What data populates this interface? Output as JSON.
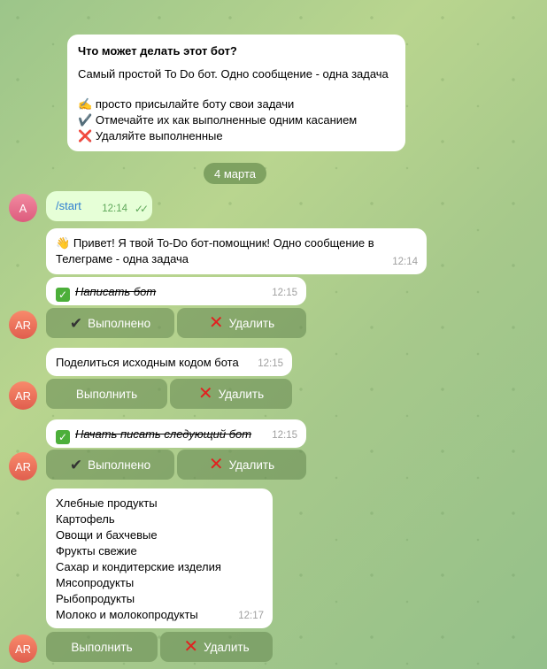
{
  "intro": {
    "title": "Что может делать этот бот?",
    "desc": "Самый простой To Do бот. Одно сообщение - одна задача",
    "line1_emoji": "✍️",
    "line1": "просто присылайте боту свои задачи",
    "line2_emoji": "✔️",
    "line2": "Отмечайте их как выполненные одним касанием",
    "line3_emoji": "❌",
    "line3": "Удаляйте выполненные"
  },
  "date_separator": "4 марта",
  "messages": [
    {
      "id": "start",
      "text": "/start",
      "time": "12:14",
      "avatar": "A"
    },
    {
      "id": "greeting",
      "emoji": "👋",
      "text": "Привет! Я твой To-Do бот-помощник! Одно сообщение в Телеграме - одна задача",
      "time": "12:14"
    },
    {
      "id": "task1",
      "emoji": "✅",
      "text": "Написать бот",
      "time": "12:15",
      "avatar": "AR",
      "done": true
    },
    {
      "id": "task2",
      "text": "Поделиться исходным кодом бота",
      "time": "12:15",
      "avatar": "AR",
      "done": false
    },
    {
      "id": "task3",
      "emoji": "✅",
      "text": "Начать писать следующий бот",
      "time": "12:15",
      "avatar": "AR",
      "done": true
    },
    {
      "id": "task4",
      "lines": [
        "Хлебные продукты",
        "Картофель",
        "Овощи и бахчевые",
        "Фрукты свежие",
        "Сахар и кондитерские изделия",
        "Мясопродукты",
        "Рыбопродукты",
        "Молоко и молокопродукты"
      ],
      "time": "12:17",
      "avatar": "AR",
      "done": false
    }
  ],
  "buttons": {
    "done": "Выполнено",
    "do": "Выполнить",
    "delete": "Удалить",
    "check_icon": "✔",
    "delete_icon": "✕"
  },
  "colors": {
    "accent": "#5fa85a",
    "delete": "#e22020",
    "out_bubble": "#e6ffd7"
  }
}
